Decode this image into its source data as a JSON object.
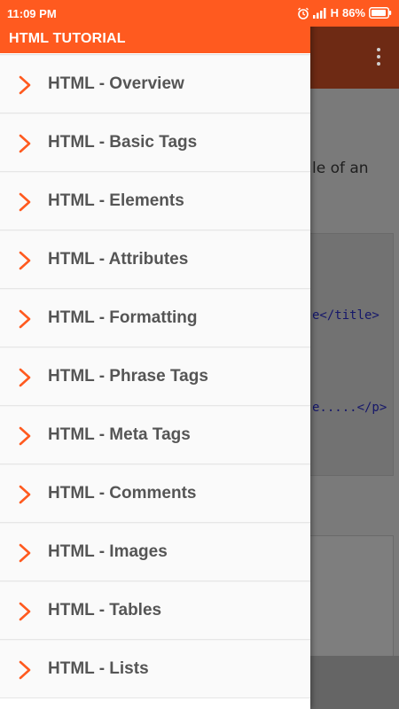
{
  "status_bar": {
    "time": "11:09 PM",
    "network": "H",
    "battery": "86%",
    "icons": [
      "alarm-icon",
      "signal-icon",
      "battery-icon"
    ]
  },
  "drawer": {
    "title": "HTML TUTORIAL",
    "items": [
      {
        "label": "HTML - Overview"
      },
      {
        "label": "HTML - Basic Tags"
      },
      {
        "label": "HTML - Elements"
      },
      {
        "label": "HTML - Attributes"
      },
      {
        "label": "HTML - Formatting"
      },
      {
        "label": "HTML - Phrase Tags"
      },
      {
        "label": "HTML - Meta Tags"
      },
      {
        "label": "HTML - Comments"
      },
      {
        "label": "HTML - Images"
      },
      {
        "label": "HTML - Tables"
      },
      {
        "label": "HTML - Lists"
      }
    ]
  },
  "background_page": {
    "text_fragment": "le of an",
    "code_lines": [
      "e</title>",
      "e.....</p>"
    ]
  },
  "colors": {
    "accent": "#ff5a1f",
    "chevron": "#ff5a1f",
    "menu_text": "#555555",
    "toolbar_dimmed": "#6e2a14"
  }
}
